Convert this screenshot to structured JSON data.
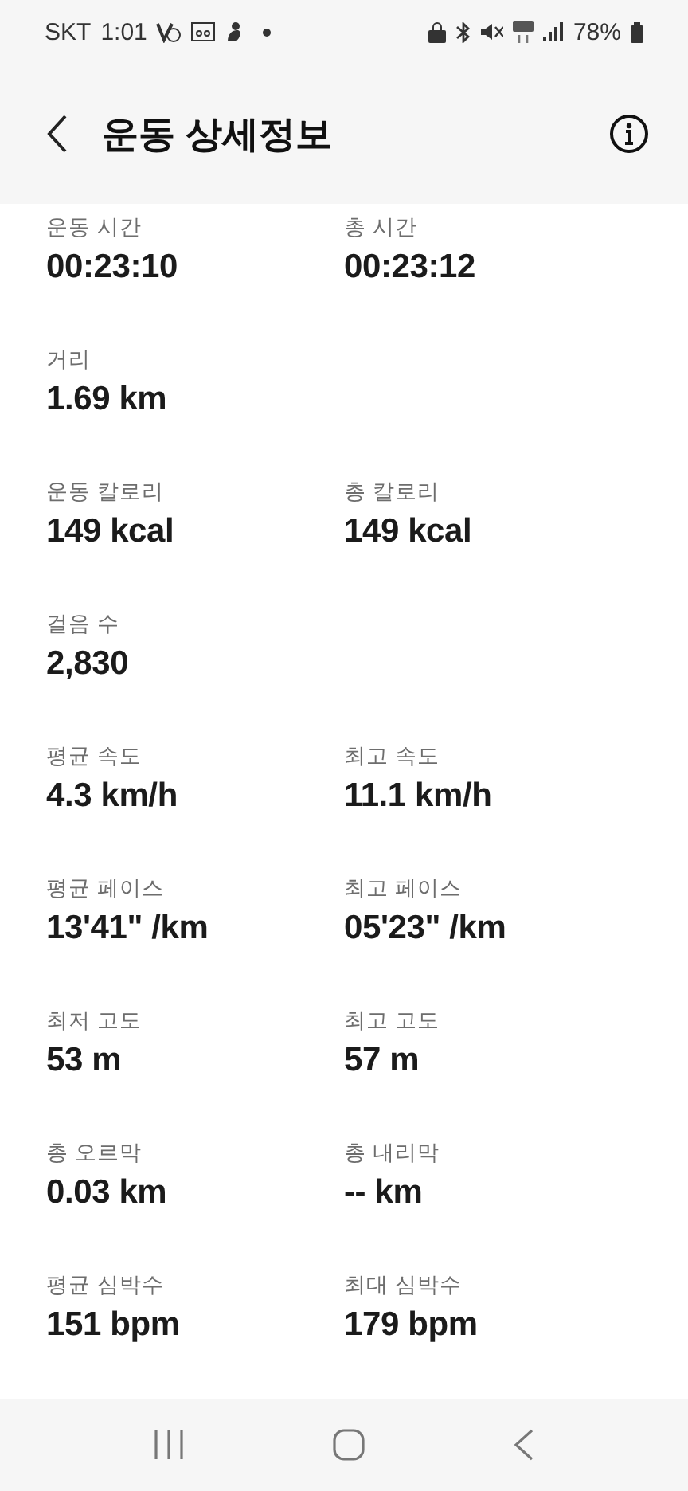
{
  "status_bar": {
    "carrier": "SKT",
    "time": "1:01",
    "battery": "78%"
  },
  "header": {
    "title": "운동 상세정보"
  },
  "rows": [
    [
      {
        "label": "운동 시간",
        "value": "00:23:10"
      },
      {
        "label": "총 시간",
        "value": "00:23:12"
      }
    ],
    [
      {
        "label": "거리",
        "value": "1.69 km"
      }
    ],
    [
      {
        "label": "운동 칼로리",
        "value": "149 kcal"
      },
      {
        "label": "총 칼로리",
        "value": "149 kcal"
      }
    ],
    [
      {
        "label": "걸음 수",
        "value": "2,830"
      }
    ],
    [
      {
        "label": "평균 속도",
        "value": "4.3 km/h"
      },
      {
        "label": "최고 속도",
        "value": "11.1 km/h"
      }
    ],
    [
      {
        "label": "평균 페이스",
        "value": "13'41\" /km"
      },
      {
        "label": "최고 페이스",
        "value": "05'23\" /km"
      }
    ],
    [
      {
        "label": "최저 고도",
        "value": "53 m"
      },
      {
        "label": "최고 고도",
        "value": "57 m"
      }
    ],
    [
      {
        "label": "총 오르막",
        "value": "0.03 km"
      },
      {
        "label": "총 내리막",
        "value": "-- km"
      }
    ],
    [
      {
        "label": "평균 심박수",
        "value": "151 bpm"
      },
      {
        "label": "최대 심박수",
        "value": "179 bpm"
      }
    ]
  ]
}
